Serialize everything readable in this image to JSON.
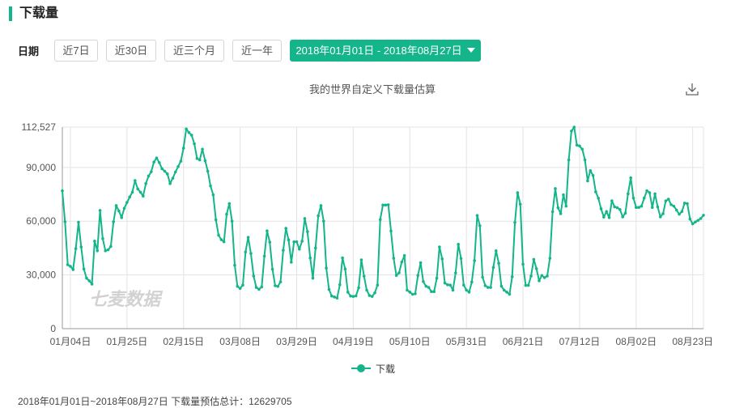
{
  "header": {
    "title": "下载量"
  },
  "filters": {
    "label": "日期",
    "buttons": [
      "近7日",
      "近30日",
      "近三个月",
      "近一年"
    ],
    "range": "2018年01月01日 - 2018年08月27日"
  },
  "colors": {
    "accent": "#14b58a",
    "grid": "#e3e3e3"
  },
  "watermark": "七麦数据",
  "footer": "2018年01月01日~2018年08月27日 下载量预估总计：12629705",
  "chart_data": {
    "type": "line",
    "title": "我的世界自定义下载量估算",
    "start_date": "2018-01-01",
    "end_date": "2018-08-27",
    "xlabel": "",
    "ylabel": "",
    "ylim": [
      0,
      112527
    ],
    "yticks": [
      "0",
      "30,000",
      "60,000",
      "90,000",
      "112,527"
    ],
    "ytick_values": [
      0,
      30000,
      60000,
      90000,
      112527
    ],
    "xtick_days": [
      3,
      24,
      45,
      66,
      87,
      108,
      129,
      150,
      171,
      192,
      213,
      234
    ],
    "xticks": [
      "01月04日",
      "01月25日",
      "02月15日",
      "03月08日",
      "03月29日",
      "04月19日",
      "05月10日",
      "05月31日",
      "06月21日",
      "07月12日",
      "08月02日",
      "08月23日"
    ],
    "grid": true,
    "legend": {
      "position": "bottom-center",
      "entries": [
        "下载"
      ]
    },
    "series": [
      {
        "name": "下载",
        "values": [
          77000,
          59700,
          35700,
          34800,
          33000,
          44700,
          59400,
          45600,
          33300,
          28200,
          26700,
          24900,
          48900,
          43500,
          66000,
          50300,
          43500,
          44000,
          45900,
          59700,
          68700,
          65700,
          62000,
          67200,
          70500,
          73500,
          76200,
          82700,
          78000,
          76200,
          74000,
          81000,
          85200,
          87600,
          93000,
          95300,
          92700,
          89300,
          87900,
          86400,
          81000,
          84000,
          87500,
          90500,
          93500,
          100800,
          111500,
          109500,
          108000,
          103200,
          95000,
          94200,
          100200,
          93800,
          87900,
          79700,
          74700,
          60800,
          52200,
          49700,
          48500,
          63900,
          69800,
          60000,
          35400,
          23600,
          22500,
          24300,
          42800,
          51000,
          42000,
          29400,
          23000,
          22000,
          23300,
          40500,
          54600,
          48300,
          33200,
          24000,
          23600,
          26100,
          43800,
          56000,
          49500,
          37100,
          48500,
          48500,
          44400,
          48900,
          61500,
          54200,
          39500,
          28200,
          45000,
          63000,
          68700,
          60000,
          33800,
          21900,
          18200,
          17700,
          17100,
          24500,
          39500,
          33300,
          20400,
          18200,
          18000,
          18300,
          22800,
          38400,
          29300,
          21500,
          18500,
          18000,
          20000,
          24300,
          60900,
          69000,
          69000,
          69200,
          54500,
          39300,
          29700,
          31200,
          37200,
          40800,
          21500,
          20400,
          19200,
          19500,
          29700,
          36800,
          26300,
          23700,
          23000,
          20700,
          20700,
          28200,
          45600,
          39000,
          25500,
          24500,
          24300,
          21500,
          31100,
          47100,
          39200,
          24300,
          21500,
          20400,
          26000,
          38000,
          63200,
          57500,
          28700,
          24000,
          23000,
          23000,
          34200,
          43500,
          36500,
          23700,
          21500,
          20400,
          19200,
          29000,
          59300,
          75900,
          69500,
          36000,
          24200,
          24200,
          29400,
          38700,
          33500,
          26700,
          29700,
          28500,
          29400,
          39300,
          65300,
          78200,
          67500,
          64200,
          74700,
          68400,
          94200,
          110300,
          112527,
          102500,
          102000,
          100200,
          94200,
          82500,
          88200,
          85500,
          76400,
          72800,
          66900,
          62300,
          65400,
          62000,
          71400,
          68000,
          67500,
          66500,
          62400,
          64500,
          75300,
          84200,
          72900,
          67700,
          67700,
          68400,
          72900,
          77000,
          75900,
          67700,
          75300,
          68000,
          62400,
          64200,
          71300,
          72300,
          69200,
          68400,
          66200,
          63900,
          65400,
          70100,
          69800,
          61200,
          58500,
          59600,
          60500,
          61500,
          63300
        ]
      }
    ]
  }
}
